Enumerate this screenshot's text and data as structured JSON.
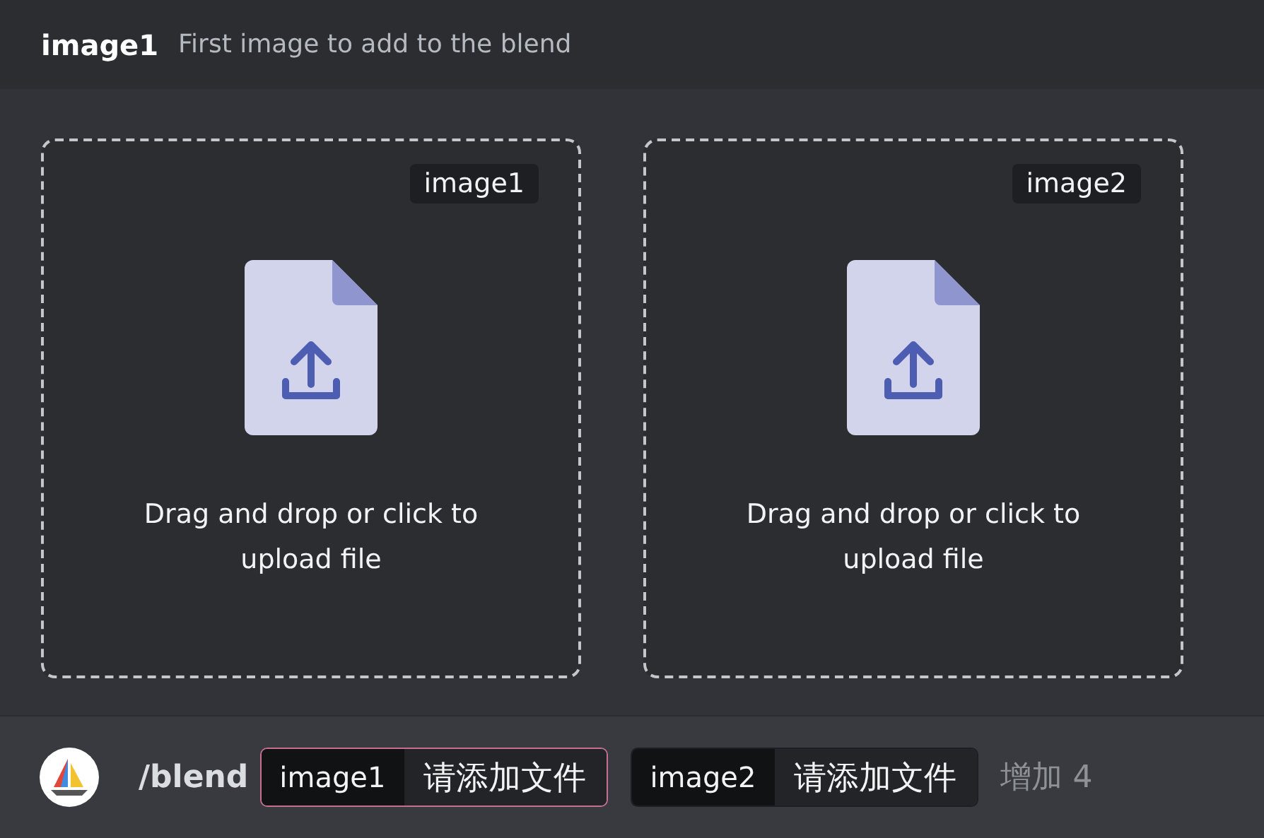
{
  "header": {
    "option": "image1",
    "description": "First image to add to the blend"
  },
  "dropzones": [
    {
      "tag": "image1",
      "text": "Drag and drop or click to upload file"
    },
    {
      "tag": "image2",
      "text": "Drag and drop or click to upload file"
    }
  ],
  "command": {
    "name": "/blend",
    "options": [
      {
        "name": "image1",
        "value": "请添加文件",
        "selected": true
      },
      {
        "name": "image2",
        "value": "请添加文件",
        "selected": false
      }
    ],
    "more": "增加 4"
  }
}
